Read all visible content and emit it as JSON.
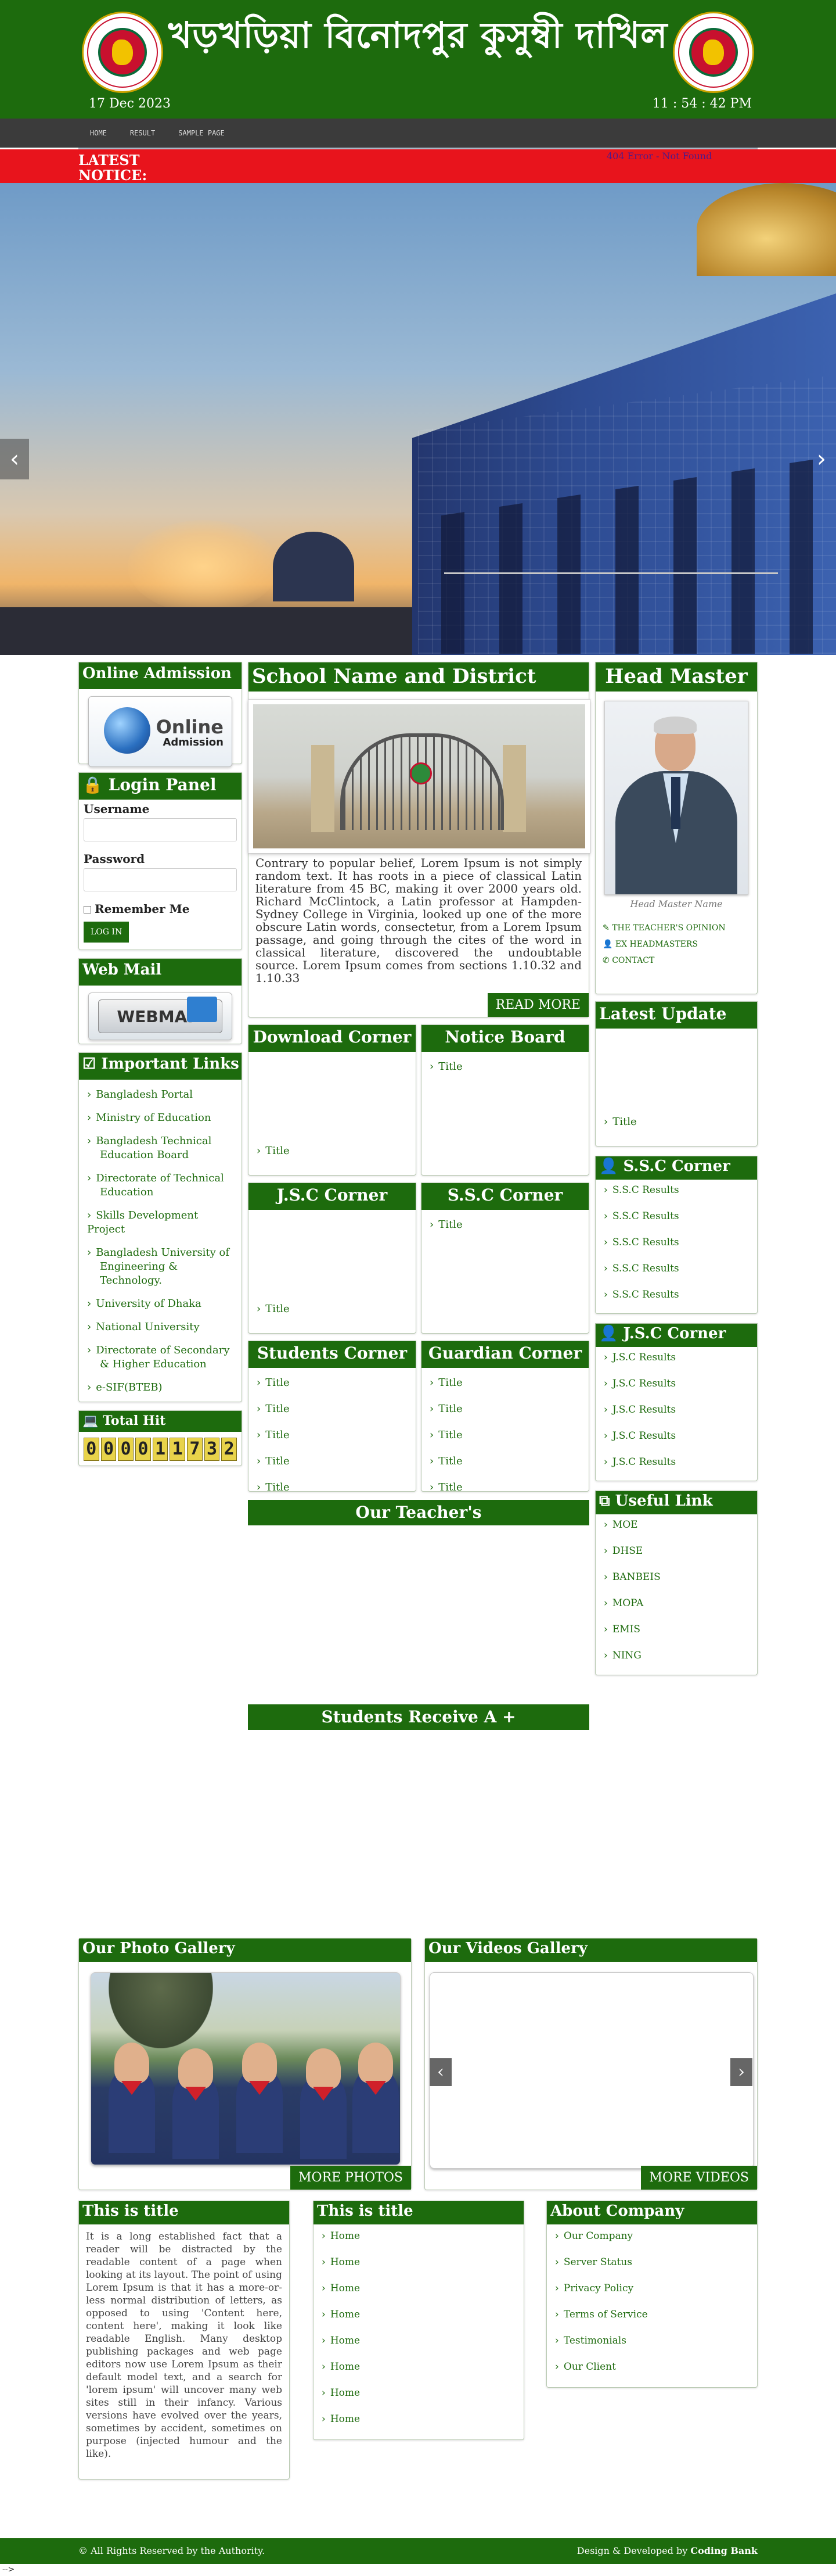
{
  "header": {
    "title": "খড়খড়িয়া বিনোদপুর কুসুম্বী দাখিল",
    "date": "17 Dec 2023",
    "time": "11 : 54 : 42 PM",
    "seal_icon": "government-seal-icon"
  },
  "nav": {
    "items": [
      "HOME",
      "RESULT",
      "SAMPLE PAGE"
    ]
  },
  "notice": {
    "label": "LATEST NOTICE:",
    "message": "404 Error - Not Found"
  },
  "slider": {
    "prev": "‹",
    "next": "›"
  },
  "left": {
    "online_admission": {
      "title": "Online Admission",
      "img_line1": "Online",
      "img_line2": "Admission"
    },
    "login": {
      "title": "Login Panel",
      "username_label": "Username",
      "password_label": "Password",
      "remember_label": "Remember Me",
      "button": "LOG IN"
    },
    "webmail": {
      "title": "Web Mail",
      "img_text": "WEBMAIL"
    },
    "important_links": {
      "title": "Important Links",
      "items": [
        "Bangladesh Portal",
        "Ministry of Education",
        "Bangladesh Technical Education Board",
        "Directorate of Technical Education",
        "Skills Development Project",
        "Bangladesh University of Engineering & Technology.",
        "University of Dhaka",
        "National University",
        "Directorate of Secondary & Higher Education",
        "e-SIF(BTEB)"
      ]
    },
    "total_hit": {
      "title": "Total Hit",
      "digits": [
        "0",
        "0",
        "0",
        "0",
        "1",
        "1",
        "7",
        "3",
        "2"
      ]
    }
  },
  "center": {
    "school": {
      "title": "School Name and District",
      "text": "Contrary to popular belief, Lorem Ipsum is not simply random text. It has roots in a piece of classical Latin literature from 45 BC, making it over 2000 years old. Richard McClintock, a Latin professor at Hampden-Sydney College in Virginia, looked up one of the more obscure Latin words, consectetur, from a Lorem Ipsum passage, and going through the cites of the word in classical literature, discovered the undoubtable source. Lorem Ipsum comes from sections 1.10.32 and 1.10.33",
      "read_more": "READ MORE"
    },
    "download_corner": {
      "title": "Download Corner",
      "items": [
        "Title"
      ]
    },
    "notice_board": {
      "title": "Notice Board",
      "items": [
        "Title"
      ]
    },
    "jsc_corner": {
      "title": "J.S.C Corner",
      "items": [
        "Title"
      ]
    },
    "ssc_corner": {
      "title": "S.S.C Corner",
      "items": [
        "Title"
      ]
    },
    "students_corner": {
      "title": "Students Corner",
      "items": [
        "Title",
        "Title",
        "Title",
        "Title",
        "Title"
      ]
    },
    "guardian_corner": {
      "title": "Guardian Corner",
      "items": [
        "Title",
        "Title",
        "Title",
        "Title",
        "Title"
      ]
    },
    "our_teachers": "Our Teacher's",
    "students_receive": "Students Receive A +"
  },
  "right": {
    "head_master": {
      "title": "Head Master",
      "caption": "Head Master Name",
      "links": [
        "THE TEACHER'S OPINION",
        "EX HEADMASTERS",
        "CONTACT"
      ]
    },
    "latest_update": {
      "title": "Latest Update",
      "items": [
        "Title"
      ]
    },
    "ssc_corner": {
      "title": "S.S.C Corner",
      "items": [
        "S.S.C Results",
        "S.S.C Results",
        "S.S.C Results",
        "S.S.C Results",
        "S.S.C Results"
      ]
    },
    "jsc_corner": {
      "title": "J.S.C Corner",
      "items": [
        "J.S.C Results",
        "J.S.C Results",
        "J.S.C Results",
        "J.S.C Results",
        "J.S.C Results"
      ]
    },
    "useful_link": {
      "title": "Useful Link",
      "items": [
        "MOE",
        "DHSE",
        "BANBEIS",
        "MOPA",
        "EMIS",
        "NING"
      ]
    }
  },
  "gallery": {
    "photo_title": "Our Photo Gallery",
    "photo_button": "MORE PHOTOS",
    "video_title": "Our Videos Gallery",
    "video_button": "MORE VIDEOS"
  },
  "bottom": {
    "col1": {
      "title": "This is title",
      "text": "It is a long established fact that a reader will be distracted by the readable content of a page when looking at its layout. The point of using Lorem Ipsum is that it has a more-or-less normal distribution of letters, as opposed to using 'Content here, content here', making it look like readable English. Many desktop publishing packages and web page editors now use Lorem Ipsum as their default model text, and a search for 'lorem ipsum' will uncover many web sites still in their infancy. Various versions have evolved over the years, sometimes by accident, sometimes on purpose (injected humour and the like)."
    },
    "col2": {
      "title": "This is title",
      "items": [
        "Home",
        "Home",
        "Home",
        "Home",
        "Home",
        "Home",
        "Home",
        "Home"
      ]
    },
    "col3": {
      "title": "About Company",
      "items": [
        "Our Company",
        "Server Status",
        "Privacy Policy",
        "Terms of Service",
        "Testimonials",
        "Our Client"
      ]
    }
  },
  "footer": {
    "left": "© All Rights Reserved by the Authority.",
    "right_prefix": "Design & Developed by",
    "right_brand": "Coding Bank",
    "stray": "-->"
  },
  "colors": {
    "brand_green": "#1d6b0d",
    "notice_red": "#e8141c",
    "nav_dark": "#3b3b3b"
  }
}
